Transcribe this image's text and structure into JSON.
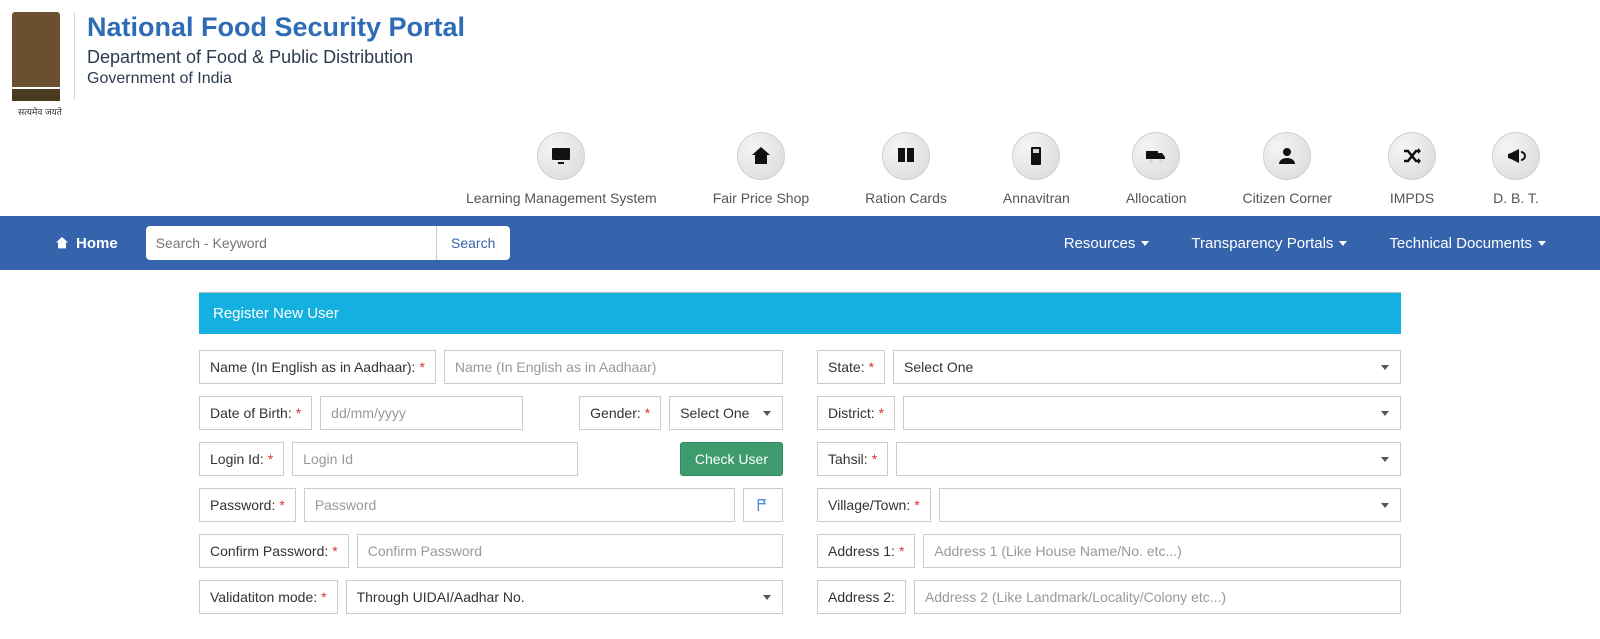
{
  "header": {
    "site_title": "National Food Security Portal",
    "subtitle1": "Department of Food & Public Distribution",
    "subtitle2": "Government of India",
    "emblem_caption": "सत्यमेव जयते"
  },
  "icon_nav": [
    {
      "label": "Learning Management System",
      "icon": "lms"
    },
    {
      "label": "Fair Price Shop",
      "icon": "shop"
    },
    {
      "label": "Ration Cards",
      "icon": "cards"
    },
    {
      "label": "Annavitran",
      "icon": "pos"
    },
    {
      "label": "Allocation",
      "icon": "truck"
    },
    {
      "label": "Citizen Corner",
      "icon": "citizen"
    },
    {
      "label": "IMPDS",
      "icon": "shuffle"
    },
    {
      "label": "D. B. T.",
      "icon": "announce"
    }
  ],
  "blue_bar": {
    "home": "Home",
    "search_placeholder": "Search - Keyword",
    "search_btn": "Search",
    "menus": [
      "Resources",
      "Transparency Portals",
      "Technical Documents"
    ]
  },
  "panel": {
    "title": "Register New User"
  },
  "form": {
    "name_label": "Name (In English as in Aadhaar):",
    "name_ph": "Name (In English as in Aadhaar)",
    "dob_label": "Date of Birth:",
    "dob_ph": "dd/mm/yyyy",
    "gender_label": "Gender:",
    "select_one": "Select One",
    "login_label": "Login Id:",
    "login_ph": "Login Id",
    "check_user": "Check User",
    "password_label": "Password:",
    "password_ph": "Password",
    "confirm_label": "Confirm Password:",
    "confirm_ph": "Confirm Password",
    "valid_label": "Validatiton mode:",
    "valid_value": "Through UIDAI/Aadhar No.",
    "state_label": "State:",
    "district_label": "District:",
    "tahsil_label": "Tahsil:",
    "village_label": "Village/Town:",
    "addr1_label": "Address 1:",
    "addr1_ph": "Address 1 (Like House Name/No. etc...)",
    "addr2_label": "Address 2:",
    "addr2_ph": "Address 2 (Like Landmark/Locality/Colony etc...)"
  }
}
